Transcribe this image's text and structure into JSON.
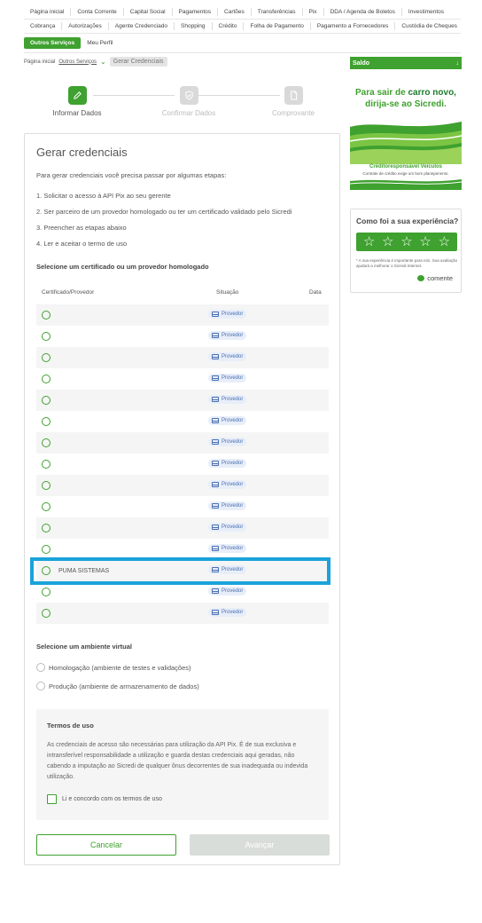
{
  "nav": {
    "row1": [
      "Página inicial",
      "Conta Corrente",
      "Capital Social",
      "Pagamentos",
      "Cartões",
      "Transferências",
      "Pix",
      "DDA / Agenda de Boletos",
      "Investimentos"
    ],
    "row2": [
      "Cobrança",
      "Autorizações",
      "Agente Credenciado",
      "Shopping",
      "Crédito",
      "Folha de Pagamento",
      "Pagamento a Fornecedores",
      "Custódia de Cheques"
    ],
    "row3_active": "Outros Serviços",
    "row3_other": "Meu Perfil"
  },
  "breadcrumb": {
    "home": "Página inicial",
    "section": "Outros Serviços",
    "current": "Gerar Credenciais"
  },
  "stepper": {
    "steps": [
      "Informar Dados",
      "Confirmar Dados",
      "Comprovante"
    ],
    "icons": [
      "pencil-icon",
      "shield-check-icon",
      "document-icon"
    ],
    "active_index": 0,
    "accent_color": "#3fa12f"
  },
  "main": {
    "title": "Gerar credenciais",
    "intro": "Para gerar credenciais você precisa passar por algumas etapas:",
    "steps": [
      "1. Solicitar o acesso à API Pix ao seu gerente",
      "2. Ser parceiro de um provedor homologado ou ter um certificado validado pelo Sicredi",
      "3. Preencher as etapas abaixo",
      "4. Ler e aceitar o termo de uso"
    ],
    "select_cert_title": "Selecione um certificado ou um provedor homologado",
    "table": {
      "headers": [
        "Certificado/Provedor",
        "Situação",
        "Data"
      ],
      "rows": [
        {
          "name": "",
          "status": "Provedor"
        },
        {
          "name": "",
          "status": "Provedor"
        },
        {
          "name": "",
          "status": "Provedor"
        },
        {
          "name": "",
          "status": "Provedor"
        },
        {
          "name": "",
          "status": "Provedor"
        },
        {
          "name": "",
          "status": "Provedor"
        },
        {
          "name": "",
          "status": "Provedor"
        },
        {
          "name": "",
          "status": "Provedor"
        },
        {
          "name": "",
          "status": "Provedor"
        },
        {
          "name": "",
          "status": "Provedor"
        },
        {
          "name": "",
          "status": "Provedor"
        },
        {
          "name": "",
          "status": "Provedor"
        },
        {
          "name": "PUMA SISTEMAS",
          "status": "Provedor"
        },
        {
          "name": "",
          "status": "Provedor"
        },
        {
          "name": "",
          "status": "Provedor"
        }
      ]
    },
    "env_title": "Selecione um ambiente virtual",
    "env_options": [
      "Homologação (ambiente de testes e validações)",
      "Produção (ambiente de armazenamento de dados)"
    ],
    "terms": {
      "title": "Termos de uso",
      "text": "As credenciais de acesso são necessárias para utilização da API Pix. É de sua exclusiva e intransferível responsabilidade a utilização e guarda destas credenciais aqui geradas, não cabendo a imputação ao Sicredi de qualquer ônus decorrentes de sua inadequada ou indevida utilização.",
      "checkbox_label": "Li e concordo com os termos de uso"
    },
    "buttons": {
      "cancel": "Cancelar",
      "next": "Avançar"
    }
  },
  "sidebar": {
    "saldo_label": "Saldo",
    "saldo_icon": "chevron-down-icon",
    "ad": {
      "line1_pre": "Para sair de ",
      "line1_bold": "carro novo,",
      "line2": "dirija-se ao Sicredi.",
      "foot1": "Créditoresponsável Veículos",
      "foot2": "Contrate de crédito exige um bom planejamento."
    },
    "feedback": {
      "title": "Como foi a sua experiência?",
      "stars": [
        "☆",
        "☆",
        "☆",
        "☆",
        "☆"
      ],
      "note": "* A sua experiência é importante para nós. Sua avaliação ajudará a melhorar o Sicredi Internet.",
      "comment": "comente"
    }
  }
}
